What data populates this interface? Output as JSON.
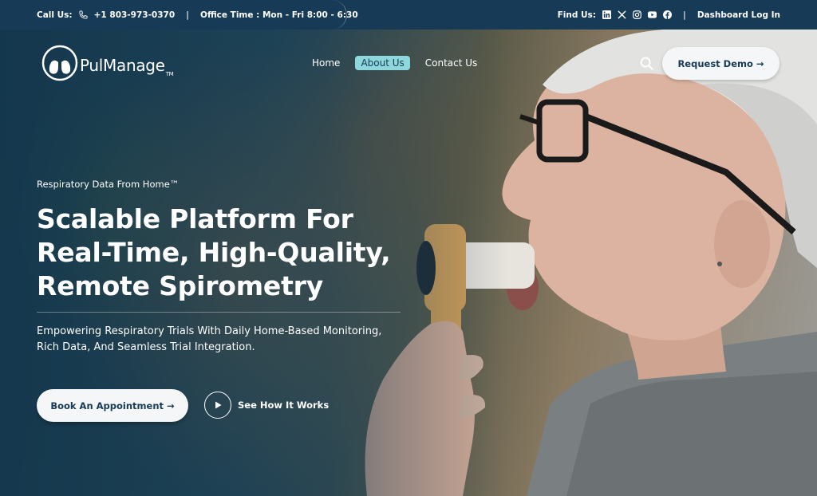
{
  "topbar": {
    "call_label": "Call Us:",
    "phone": "+1 803-973-0370",
    "separator": "|",
    "office_time": "Office Time : Mon - Fri 8:00 - 6:30",
    "find_us_label": "Find Us:",
    "social_icons": [
      "linkedin-icon",
      "x-icon",
      "instagram-icon",
      "youtube-icon",
      "facebook-icon"
    ],
    "dashboard_login": "Dashboard Log In"
  },
  "logo": {
    "text": "PulManage",
    "tm": "TM"
  },
  "nav": {
    "items": [
      {
        "label": "Home"
      },
      {
        "label": "About Us",
        "active": true
      },
      {
        "label": "Contact Us"
      }
    ],
    "demo_button": "Request Demo →"
  },
  "hero": {
    "eyebrow": "Respiratory Data From Home™",
    "headline_lines": [
      "Scalable Platform For",
      "Real-Time, High-Quality,",
      "Remote Spirometry"
    ],
    "subtitle_lines": [
      "Empowering Respiratory Trials With Daily Home-Based Monitoring,",
      "Rich Data, And Seamless Trial Integration."
    ],
    "book_button": "Book An Appointment →",
    "play_label": "See How It Works"
  },
  "colors": {
    "topbar": "#173a57",
    "accent": "#8ed8dd",
    "button_bg": "#f4f6f7",
    "button_text": "#173a57"
  }
}
